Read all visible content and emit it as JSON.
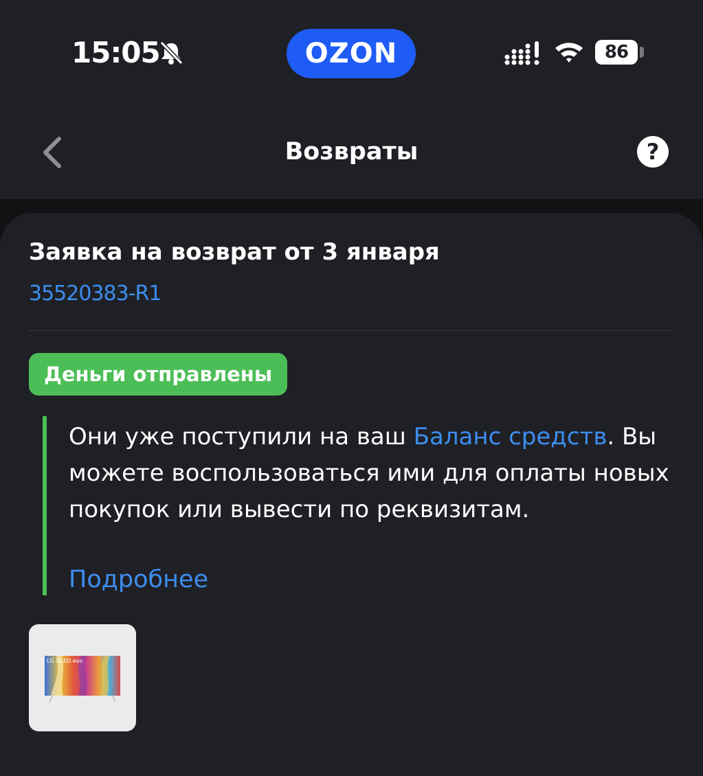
{
  "status_bar": {
    "time": "15:05",
    "bell_icon": "bell-slash-icon",
    "brand": "OZON",
    "brand_color": "#1f5cf6",
    "signal_icon": "cellular-signal-icon",
    "wifi_icon": "wifi-icon",
    "battery_level": "86"
  },
  "nav": {
    "back_icon": "chevron-left-icon",
    "title": "Возвраты",
    "help_label": "?"
  },
  "request": {
    "title": "Заявка на возврат от 3 января",
    "id": "35520383-R1",
    "status": "Деньги отправлены",
    "status_color": "#4cbe57",
    "message_part1": "Они уже поступили на ваш ",
    "message_link": "Баланс средств",
    "message_part2": ". Вы можете воспользоваться ими для оплаты новых покупок или вывести по реквизитам.",
    "more_link": "Подробнее",
    "link_color": "#3d8ef0"
  },
  "product": {
    "image_icon": "tv-product-image",
    "brand_text": "LG OLED evo"
  }
}
